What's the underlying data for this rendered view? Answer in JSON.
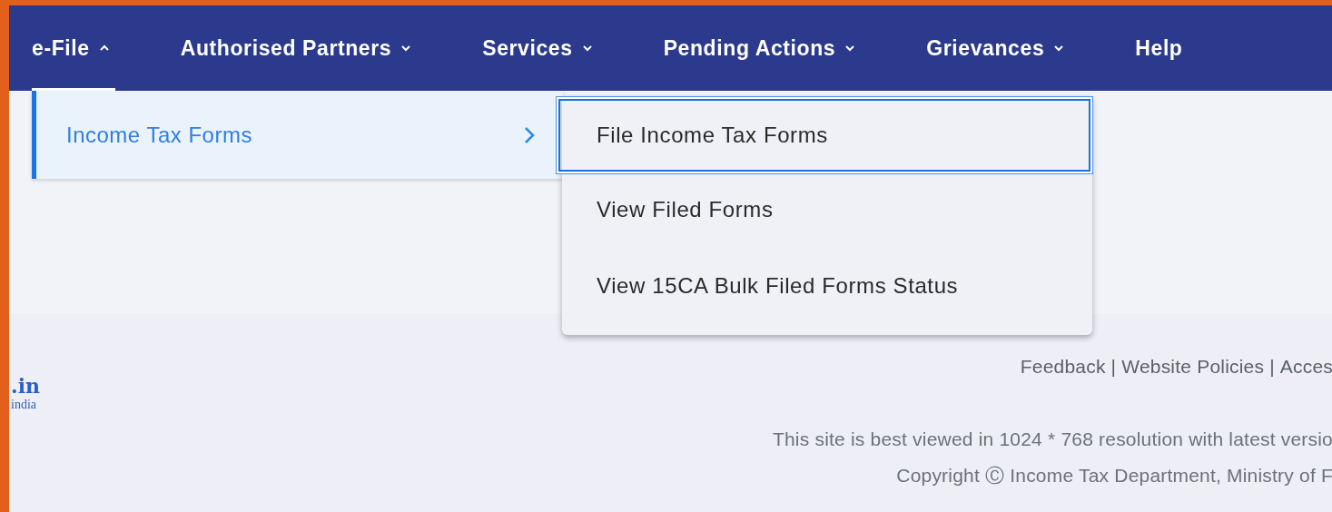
{
  "nav": [
    {
      "label": "e-File",
      "expanded": true,
      "selected": true
    },
    {
      "label": "Authorised Partners",
      "expanded": false,
      "selected": false
    },
    {
      "label": "Services",
      "expanded": false,
      "selected": false
    },
    {
      "label": "Pending Actions",
      "expanded": false,
      "selected": false
    },
    {
      "label": "Grievances",
      "expanded": false,
      "selected": false
    },
    {
      "label": "Help",
      "selected": false
    }
  ],
  "menu": {
    "items": [
      {
        "label": "Income Tax Forms",
        "selected": true
      }
    ]
  },
  "submenu": {
    "items": [
      {
        "label": "File Income Tax Forms",
        "selected": true
      },
      {
        "label": "View Filed Forms",
        "selected": false
      },
      {
        "label": "View 15CA Bulk Filed Forms Status",
        "selected": false
      }
    ]
  },
  "footer": {
    "logo": ".in",
    "logo_sub": "india",
    "separator": "|",
    "links": [
      "Feedback",
      "Website Policies",
      "Acces"
    ],
    "note": "This site is best viewed in 1024 * 768 resolution with latest versio",
    "copyright": "Copyright Ⓒ Income Tax Department, Ministry of F"
  }
}
